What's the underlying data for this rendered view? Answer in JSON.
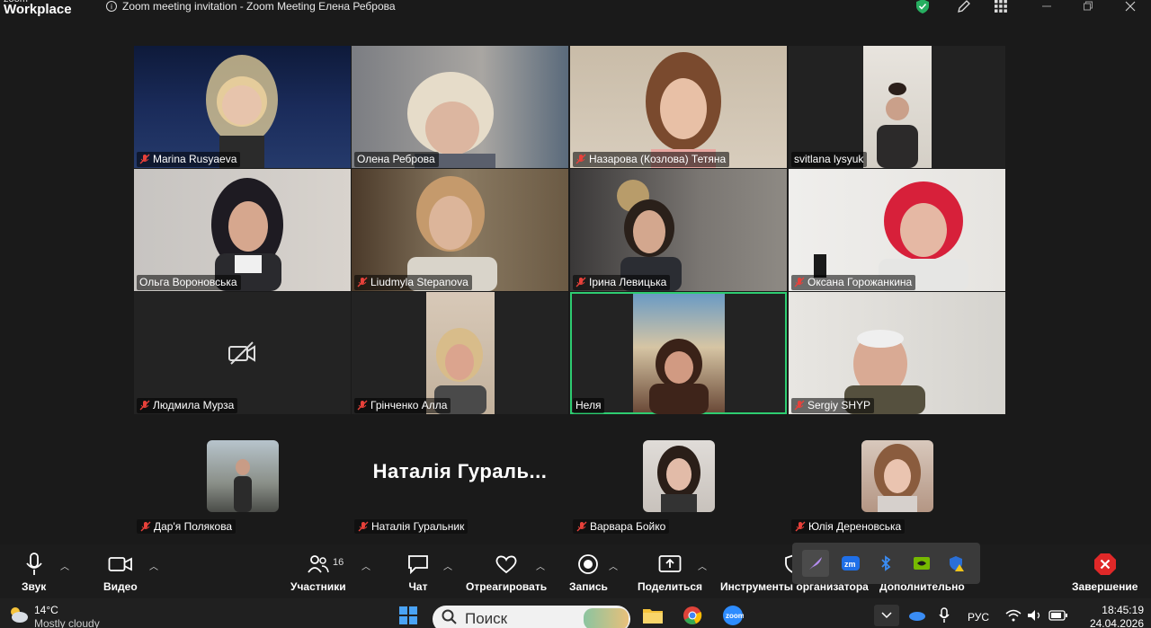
{
  "app": {
    "logo_top": "zoom",
    "logo_bottom": "Workplace",
    "meeting_title": "Zoom meeting invitation - Zoom Meeting Елена Реброва"
  },
  "colors": {
    "active_speaker": "#2ecc71",
    "muted": "#e8413a"
  },
  "participants": [
    {
      "name": "Marina Rusyaeva",
      "muted": true
    },
    {
      "name": "Олена Реброва",
      "muted": false
    },
    {
      "name": "Назарова (Козлова) Тетяна",
      "muted": true
    },
    {
      "name": "svitlana lysyuk",
      "muted": false
    },
    {
      "name": "Ольга Вороновська",
      "muted": false
    },
    {
      "name": "Liudmyla Stepanova",
      "muted": true
    },
    {
      "name": "Ірина Левицька",
      "muted": true
    },
    {
      "name": "Оксана Горожанкина",
      "muted": true
    },
    {
      "name": "Людмила Мурза",
      "muted": true
    },
    {
      "name": "Грінченко Алла",
      "muted": true
    },
    {
      "name": "Неля",
      "muted": false
    },
    {
      "name": "Sergiy SHYP",
      "muted": true
    }
  ],
  "avatars": [
    {
      "name": "Дар'я Полякова"
    },
    {
      "name": "Наталія Гуральник",
      "display": "Наталія Гураль..."
    },
    {
      "name": "Варвара Бойко"
    },
    {
      "name": "Юлія Дереновська"
    }
  ],
  "toolbar": {
    "audio": "Звук",
    "video": "Видео",
    "participants": "Участники",
    "participants_count": "16",
    "chat": "Чат",
    "react": "Отреагировать",
    "record": "Запись",
    "share": "Поделиться",
    "host_tools": "Инструменты организатора",
    "more": "Дополнительно",
    "end": "Завершение"
  },
  "taskbar": {
    "temp": "14°C",
    "weather": "Mostly cloudy",
    "search": "Поиск",
    "lang": "РУС",
    "time": "18:45:19",
    "date": "24.04.2026"
  }
}
